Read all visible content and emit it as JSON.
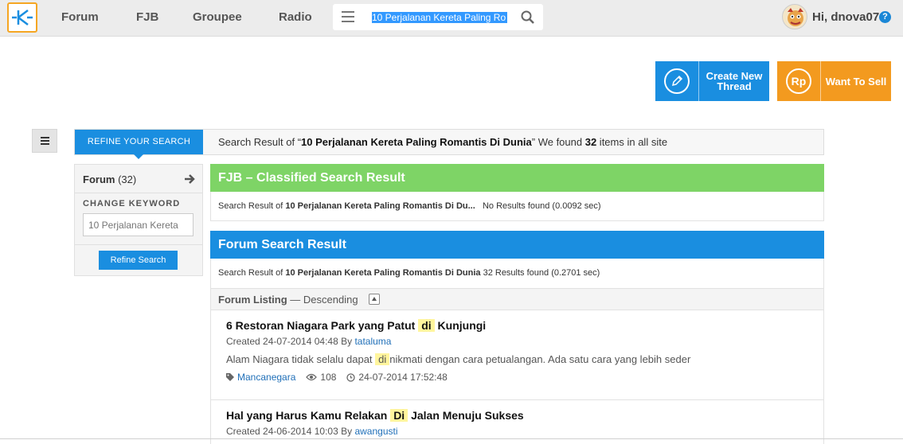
{
  "nav": {
    "links": [
      "Forum",
      "FJB",
      "Groupee",
      "Radio"
    ],
    "search_value": "10 Perjalanan Kereta Paling Ro"
  },
  "user": {
    "greeting": "Hi, dnova07",
    "help": "?"
  },
  "actions": {
    "create_thread": "Create New Thread",
    "sell": "Want To Sell",
    "sell_icon_text": "Rp"
  },
  "search": {
    "refine_tab": "REFINE YOUR SEARCH",
    "summary_prefix": "Search Result of “",
    "query": "10 Perjalanan Kereta Paling Romantis Di Dunia",
    "summary_mid": "” We found ",
    "count": "32",
    "summary_suffix": " items in all site"
  },
  "refine": {
    "forum_label": "Forum",
    "forum_count": "(32)",
    "change_keyword": "CHANGE KEYWORD",
    "keyword_placeholder": "10 Perjalanan Kereta",
    "button": "Refine Search"
  },
  "fjb": {
    "title": "FJB – Classified Search Result",
    "prefix": "Search Result of ",
    "query": "10 Perjalanan Kereta Paling Romantis Di Du...",
    "status": "No Results found (0.0092 sec)"
  },
  "forum": {
    "title": "Forum Search Result",
    "prefix": "Search Result of ",
    "query": "10 Perjalanan Kereta Paling Romantis Di Dunia",
    "status": "32 Results found (0.2701 sec)",
    "listing_label": "Forum Listing",
    "listing_order": "— Descending"
  },
  "threads": [
    {
      "title_before": "6 Restoran Niagara Park yang Patut ",
      "title_hl": "di",
      "title_after": " Kunjungi",
      "created": "Created 24-07-2014 04:48 By ",
      "author": "tataluma",
      "excerpt_before": "Alam Niagara tidak selalu dapat ",
      "excerpt_hl": "di",
      "excerpt_after": "nikmati dengan cara petualangan. Ada satu cara yang lebih seder",
      "category": "Mancanegara",
      "views": "108",
      "last_post": "24-07-2014 17:52:48"
    },
    {
      "title_before": "Hal yang Harus Kamu Relakan ",
      "title_hl": "Di",
      "title_after": " Jalan Menuju Sukses",
      "created": "Created 24-06-2014 10:03 By ",
      "author": "awangusti"
    }
  ]
}
